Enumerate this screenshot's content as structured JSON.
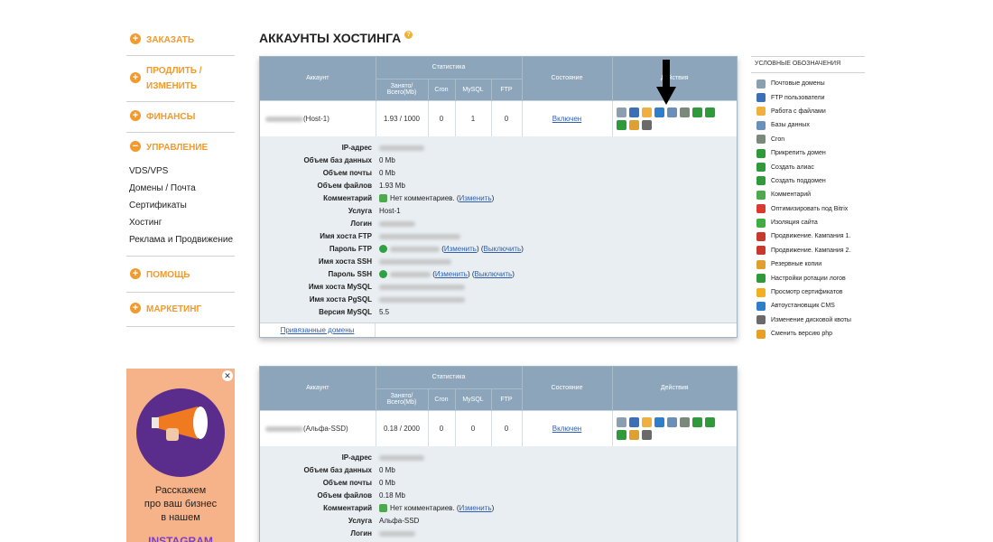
{
  "sidebar": {
    "order": "ЗАКАЗАТЬ",
    "renew": "ПРОДЛИТЬ / ИЗМЕНИТЬ",
    "finance": "ФИНАНСЫ",
    "manage": "УПРАВЛЕНИЕ",
    "manage_items": [
      "VDS/VPS",
      "Домены / Почта",
      "Сертификаты",
      "Хостинг",
      "Реклама и Продвижение"
    ],
    "help": "ПОМОЩЬ",
    "marketing": "МАРКЕТИНГ"
  },
  "ad": {
    "line1": "Расскажем",
    "line2": "про ваш бизнес",
    "line3": "в нашем",
    "line4": "INSTAGRAM"
  },
  "page": {
    "title": "АККАУНТЫ ХОСТИНГА"
  },
  "table_headers": {
    "account": "Аккаунт",
    "stats": "Статистика",
    "used": "Занято/ Всего(Mb)",
    "cron": "Cron",
    "mysql": "MySQL",
    "ftp": "FTP",
    "state": "Состояние",
    "actions": "Действия"
  },
  "accounts": [
    {
      "name": "(Host-1)",
      "used": "1.93 / 1000",
      "cron": "0",
      "mysql": "1",
      "ftp": "0",
      "state": "Включен",
      "details": {
        "ip_label": "IP-адрес",
        "db_label": "Объем баз данных",
        "db_value": "0 Mb",
        "mail_label": "Объем почты",
        "mail_value": "0 Mb",
        "files_label": "Объем файлов",
        "files_value": "1.93 Mb",
        "comment_label": "Комментарий",
        "comment_value": "Нет комментариев.",
        "change": "Изменить",
        "service_label": "Услуга",
        "service_value": "Host-1",
        "login_label": "Логин",
        "ftp_host_label": "Имя хоста FTP",
        "ftp_pass_label": "Пароль FTP",
        "ssh_host_label": "Имя хоста SSH",
        "ssh_pass_label": "Пароль SSH",
        "disable": "Выключить",
        "mysql_host_label": "Имя хоста MySQL",
        "pgsql_host_label": "Имя хоста PgSQL",
        "mysql_ver_label": "Версия MySQL",
        "mysql_ver_value": "5.5"
      },
      "linked_domains": "Привязанные домены"
    },
    {
      "name": "(Альфа-SSD)",
      "used": "0.18 / 2000",
      "cron": "0",
      "mysql": "0",
      "ftp": "0",
      "state": "Включен",
      "details": {
        "ip_label": "IP-адрес",
        "db_label": "Объем баз данных",
        "db_value": "0 Mb",
        "mail_label": "Объем почты",
        "mail_value": "0 Mb",
        "files_label": "Объем файлов",
        "files_value": "0.18 Mb",
        "comment_label": "Комментарий",
        "comment_value": "Нет комментариев.",
        "change": "Изменить",
        "service_label": "Услуга",
        "service_value": "Альфа-SSD",
        "login_label": "Логин"
      }
    }
  ],
  "legend": {
    "title": "УСЛОВНЫЕ ОБОЗНАЧЕНИЯ",
    "items": [
      {
        "label": "Почтовые домены",
        "color": "#8aa0b0"
      },
      {
        "label": "FTP пользователи",
        "color": "#3b6fb6"
      },
      {
        "label": "Работа с файлами",
        "color": "#f0b040"
      },
      {
        "label": "Базы данных",
        "color": "#6a8fb8"
      },
      {
        "label": "Cron",
        "color": "#7a8a7a"
      },
      {
        "label": "Прикрепить домен",
        "color": "#2e9a3a"
      },
      {
        "label": "Создать алиас",
        "color": "#2e9a3a"
      },
      {
        "label": "Создать поддомен",
        "color": "#2e9a3a"
      },
      {
        "label": "Комментарий",
        "color": "#4caa4c"
      },
      {
        "label": "Оптимизировать под Bitrix",
        "color": "#d83a2e"
      },
      {
        "label": "Изоляция сайта",
        "color": "#3fae3f"
      },
      {
        "label": "Продвижение. Кампания 1.",
        "color": "#c8382c"
      },
      {
        "label": "Продвижение. Кампания 2.",
        "color": "#c8382c"
      },
      {
        "label": "Резервные копии",
        "color": "#e0a030"
      },
      {
        "label": "Настройки ротации логов",
        "color": "#2e9a3a"
      },
      {
        "label": "Просмотр сертификатов",
        "color": "#f0b020"
      },
      {
        "label": "Автоустановщик CMS",
        "color": "#2f7fc8"
      },
      {
        "label": "Изменение дисковой квоты",
        "color": "#6a6a6a"
      },
      {
        "label": "Сменить версию php",
        "color": "#e8a020"
      }
    ]
  },
  "action_icon_colors": [
    "#8aa0b0",
    "#3b6fb6",
    "#f0b040",
    "#2f7fc8",
    "#6a8fb8",
    "#7a8a7a",
    "#2e9a3a",
    "#2e9a3a",
    "#2e9a3a",
    "#e0a030",
    "#6a6a6a"
  ]
}
